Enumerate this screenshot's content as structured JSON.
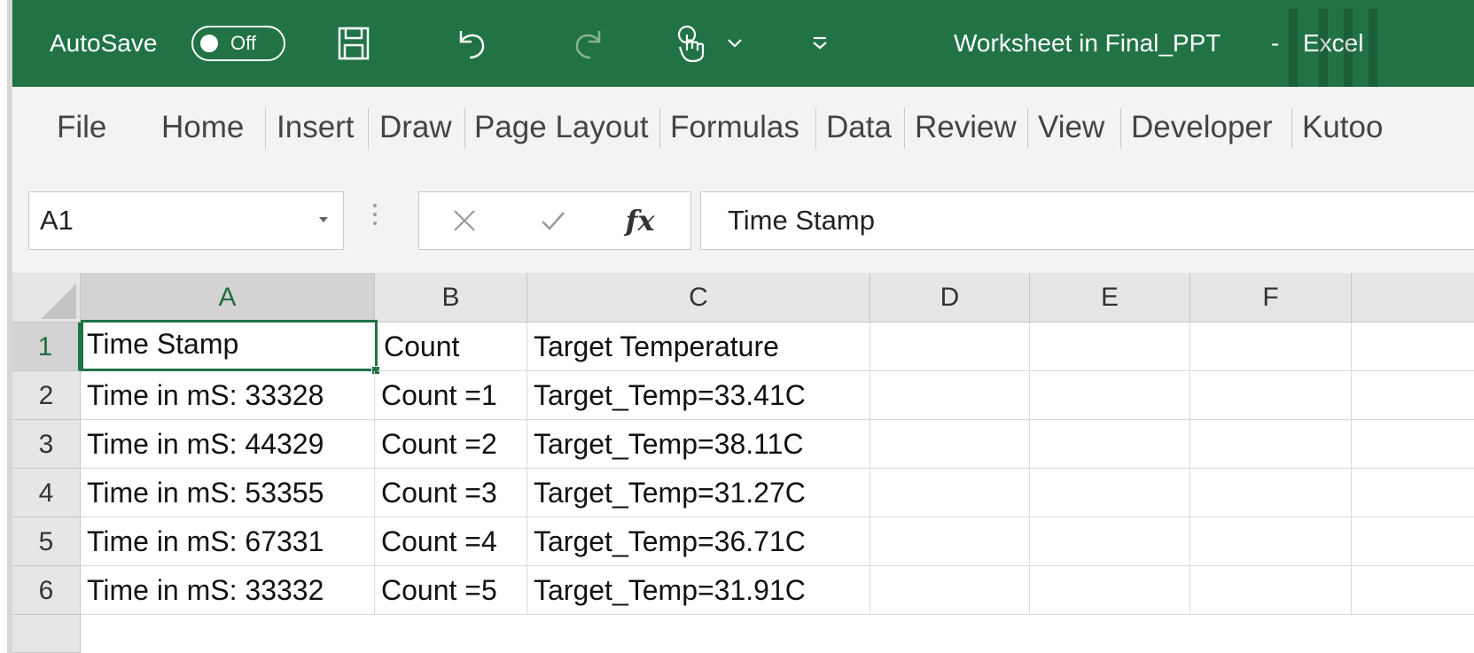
{
  "title_bar": {
    "autosave_label": "AutoSave",
    "autosave_state": "Off",
    "document_title": "Worksheet in Final_PPT",
    "separator": "-",
    "app_name": "Excel",
    "icons": [
      "save-icon",
      "undo-icon",
      "redo-icon",
      "touch-mode-icon",
      "chevron-down-icon",
      "customize-toolbar-icon"
    ],
    "brand_color": "#217346"
  },
  "ribbon": {
    "tabs": [
      "File",
      "Home",
      "Insert",
      "Draw",
      "Page Layout",
      "Formulas",
      "Data",
      "Review",
      "View",
      "Developer",
      "Kutoo"
    ]
  },
  "formula_bar": {
    "name_box": "A1",
    "fx_label": "fx",
    "formula": "Time Stamp"
  },
  "sheet": {
    "columns": [
      "A",
      "B",
      "C",
      "D",
      "E",
      "F"
    ],
    "selected_column": "A",
    "selected_row": "1",
    "active_cell": "A1",
    "rows": [
      {
        "num": "1",
        "cells": [
          "Time Stamp",
          "Count",
          "Target Temperature",
          "",
          "",
          ""
        ]
      },
      {
        "num": "2",
        "cells": [
          "Time in mS: 33328",
          "Count =1",
          "Target_Temp=33.41C",
          "",
          "",
          ""
        ]
      },
      {
        "num": "3",
        "cells": [
          "Time in mS: 44329",
          "Count =2",
          "Target_Temp=38.11C",
          "",
          "",
          ""
        ]
      },
      {
        "num": "4",
        "cells": [
          "Time in mS: 53355",
          "Count =3",
          "Target_Temp=31.27C",
          "",
          "",
          ""
        ]
      },
      {
        "num": "5",
        "cells": [
          "Time in mS: 67331",
          "Count =4",
          "Target_Temp=36.71C",
          "",
          "",
          ""
        ]
      },
      {
        "num": "6",
        "cells": [
          "Time in mS: 33332",
          "Count =5",
          "Target_Temp=31.91C",
          "",
          "",
          ""
        ]
      }
    ]
  }
}
